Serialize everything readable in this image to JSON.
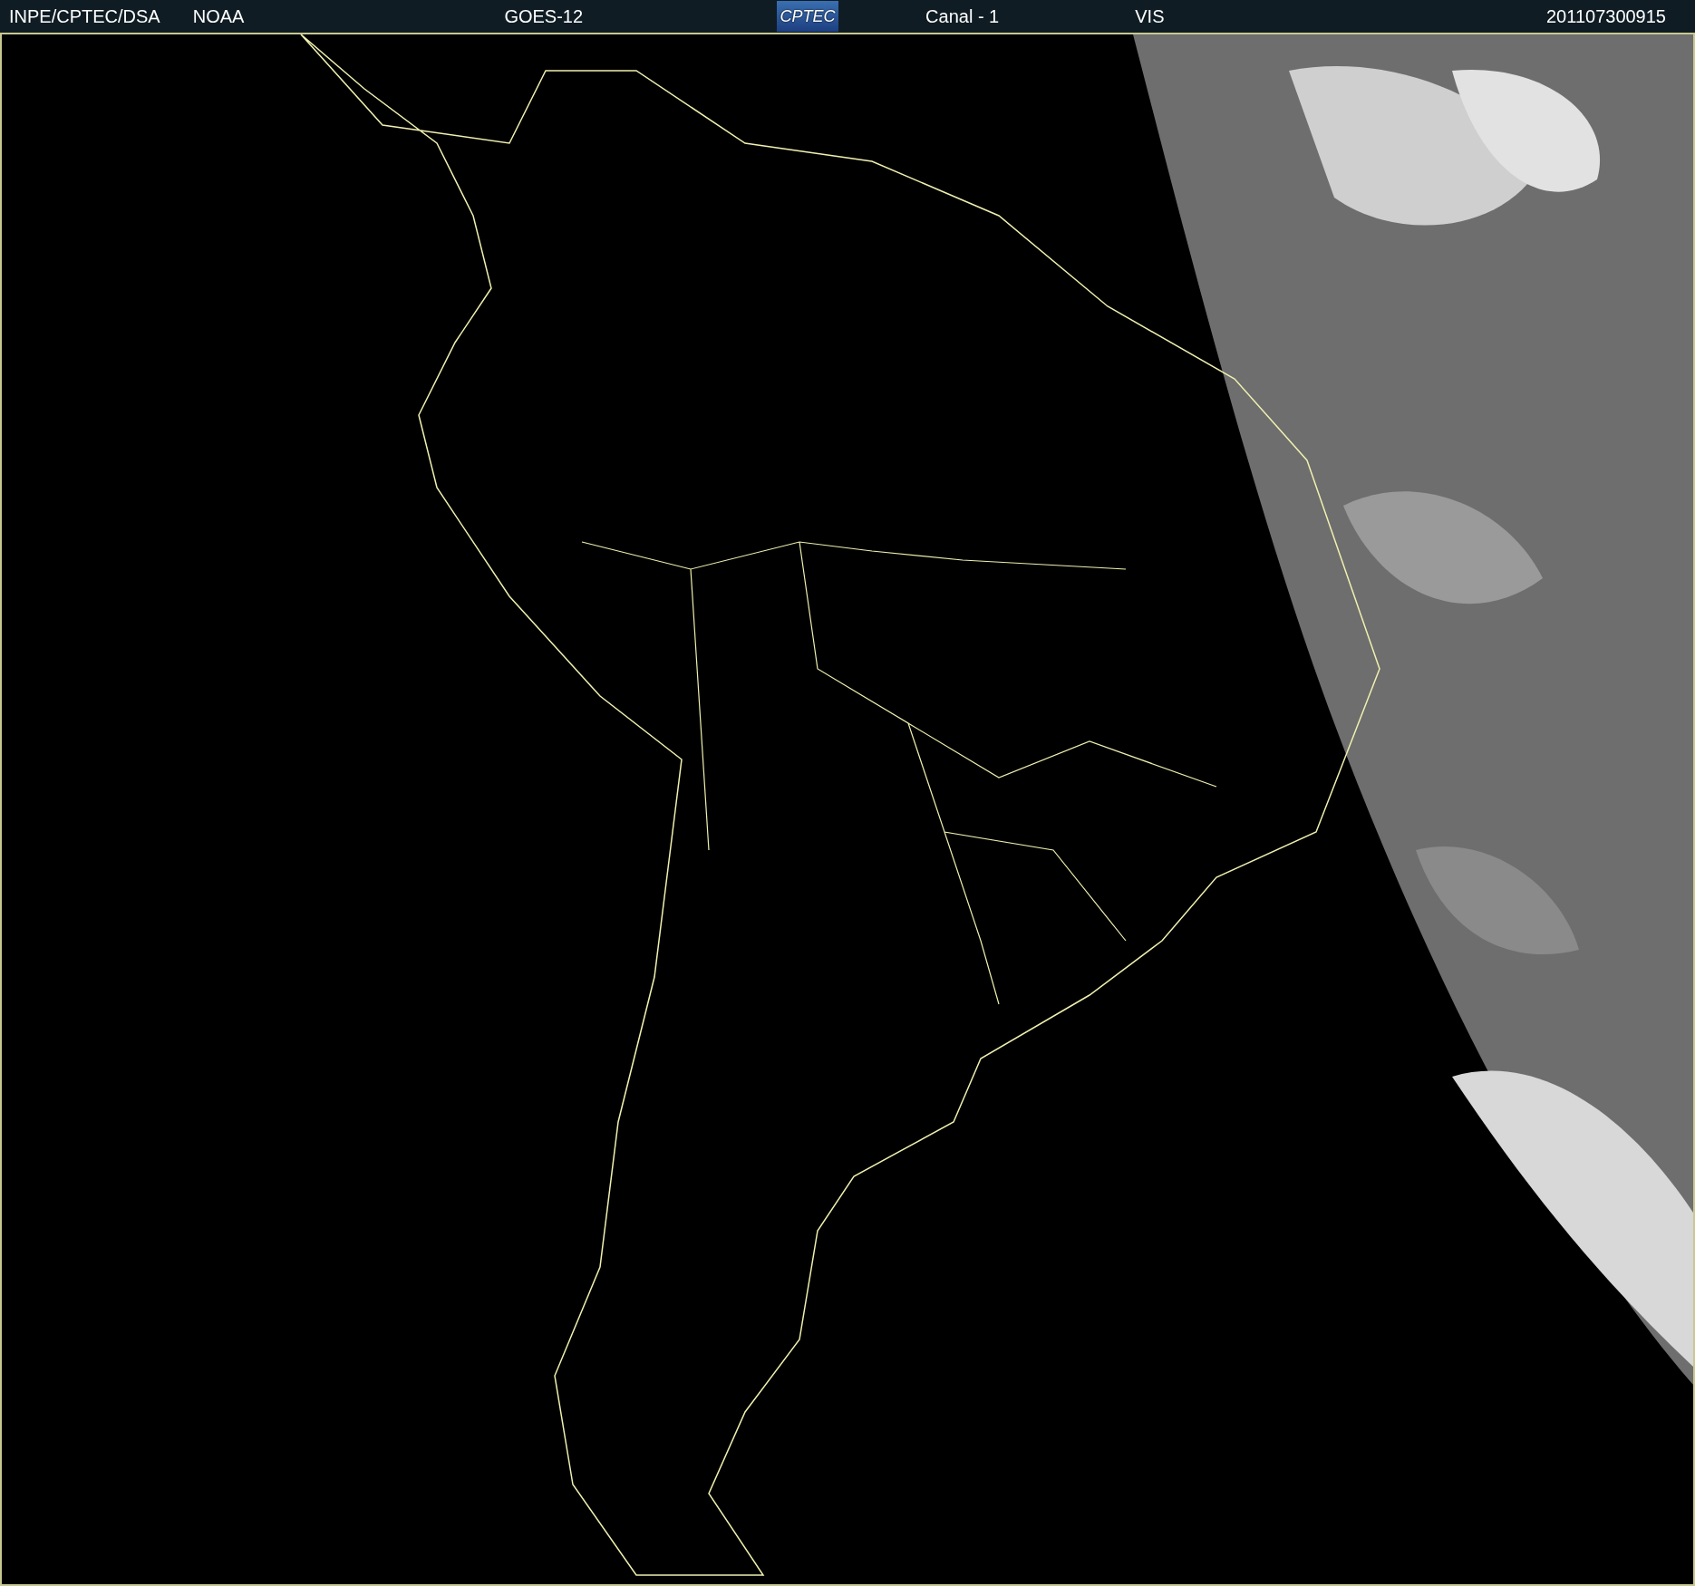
{
  "header": {
    "source": "INPE/CPTEC/DSA",
    "agency": "NOAA",
    "satellite": "GOES-12",
    "logo": "CPTEC",
    "channel": "Canal - 1",
    "band": "VIS",
    "timestamp": "201107300915"
  }
}
